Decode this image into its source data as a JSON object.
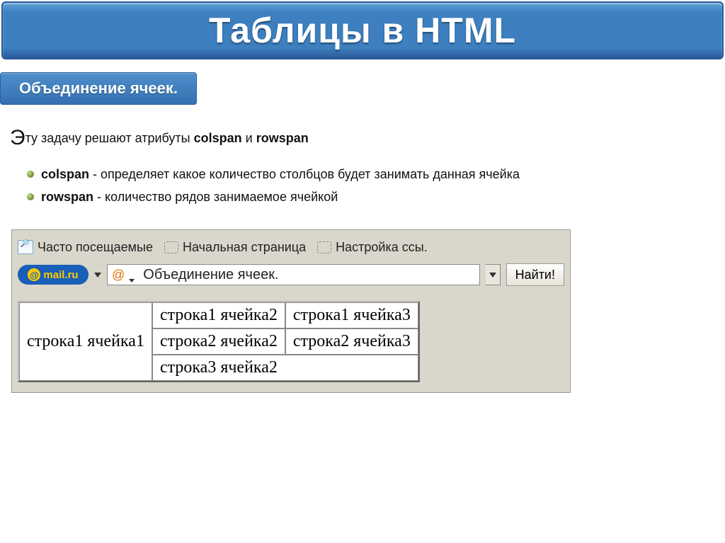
{
  "title": "Таблицы в HTML",
  "subtitle": "Объединение ячеек.",
  "intro_dropcap": "Э",
  "intro_rest": "ту задачу решают атрибуты ",
  "intro_attr1": "colspan",
  "intro_and": " и ",
  "intro_attr2": "rowspan",
  "bullets": [
    {
      "term": "colspan",
      "desc": " - определяет какое количество столбцов будет занимать данная ячейка"
    },
    {
      "term": "rowspan",
      "desc": " - количество рядов занимаемое ячейкой"
    }
  ],
  "bookmarks": {
    "item1": "Часто посещаемые",
    "item2": "Начальная страница",
    "item3": "Настройка ссы."
  },
  "mail_logo": "mail.ru",
  "search_value": "Объединение ячеек.",
  "find_label": "Найти!",
  "table": {
    "r1c1": "строка1 ячейка1",
    "r1c2": "строка1 ячейка2",
    "r1c3": "строка1 ячейка3",
    "r2c2": "строка2 ячейка2",
    "r2c3": "строка2 ячейка3",
    "r3c2": "строка3 ячейка2"
  }
}
